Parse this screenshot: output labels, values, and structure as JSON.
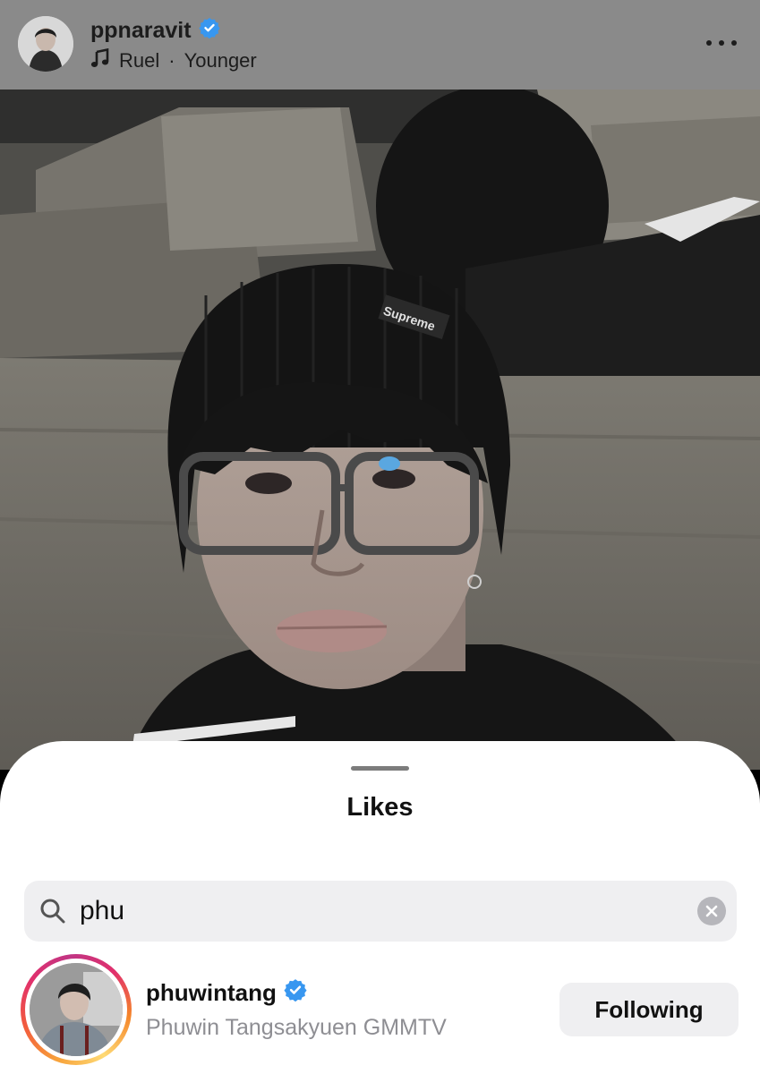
{
  "post_header": {
    "username": "ppnaravit",
    "verified": true,
    "music_artist": "Ruel",
    "music_separator": "·",
    "music_title": "Younger",
    "more_icon": "more-horizontal-icon",
    "background_color": "#8a8a8a"
  },
  "post_image": {
    "cap_text": "Supreme"
  },
  "likes_sheet": {
    "title": "Likes",
    "search": {
      "value": "phu",
      "icon": "search-icon",
      "clear_icon": "clear-icon"
    },
    "results": [
      {
        "username": "phuwintang",
        "verified": true,
        "full_name": "Phuwin Tangsakyuen GMMTV",
        "has_story": true,
        "button_label": "Following"
      }
    ]
  },
  "colors": {
    "verified_badge": "#3897f0",
    "button_bg": "#efeff1",
    "secondary_text": "#8e8e93"
  }
}
